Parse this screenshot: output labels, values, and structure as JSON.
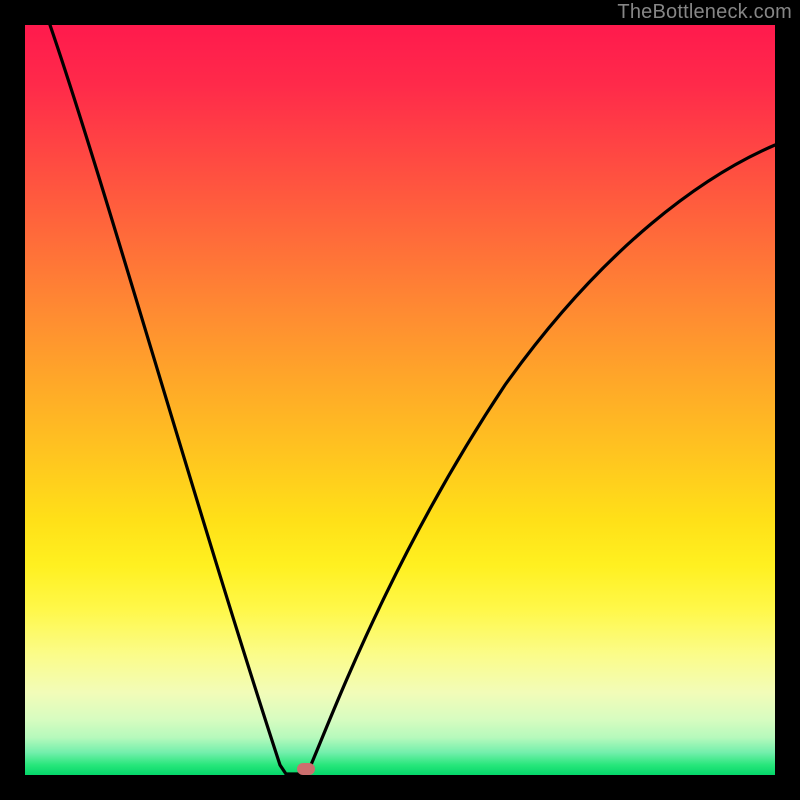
{
  "watermark": "TheBottleneck.com",
  "marker": {
    "x_pct": 37.5,
    "y_pct": 99.2,
    "color": "#cc6e6e"
  },
  "chart_data": {
    "type": "line",
    "title": "",
    "xlabel": "",
    "ylabel": "",
    "xlim": [
      0,
      100
    ],
    "ylim": [
      0,
      100
    ],
    "grid": false,
    "legend": false,
    "series": [
      {
        "name": "left-branch",
        "x": [
          3.3,
          6,
          10,
          14,
          18,
          22,
          26,
          30,
          33,
          35,
          36.5,
          37.5
        ],
        "y": [
          100,
          92,
          80,
          68,
          56,
          44,
          33,
          22,
          13,
          6,
          1.2,
          0.12
        ]
      },
      {
        "name": "right-branch",
        "x": [
          37.5,
          39,
          41,
          44,
          48,
          53,
          59,
          66,
          74,
          83,
          92,
          100
        ],
        "y": [
          0.12,
          1.5,
          5,
          11,
          19,
          28,
          37,
          46,
          54,
          61,
          67,
          71
        ]
      },
      {
        "name": "flat-bottom",
        "x": [
          34.8,
          37.5
        ],
        "y": [
          0.12,
          0.12
        ]
      }
    ],
    "gradient_stops": [
      {
        "pct": 0,
        "color": "#ff1a4d"
      },
      {
        "pct": 18,
        "color": "#ff4a42"
      },
      {
        "pct": 38,
        "color": "#ff8a32"
      },
      {
        "pct": 58,
        "color": "#ffc71f"
      },
      {
        "pct": 78,
        "color": "#fff84a"
      },
      {
        "pct": 92,
        "color": "#d8fcc0"
      },
      {
        "pct": 100,
        "color": "#04d66a"
      }
    ]
  }
}
